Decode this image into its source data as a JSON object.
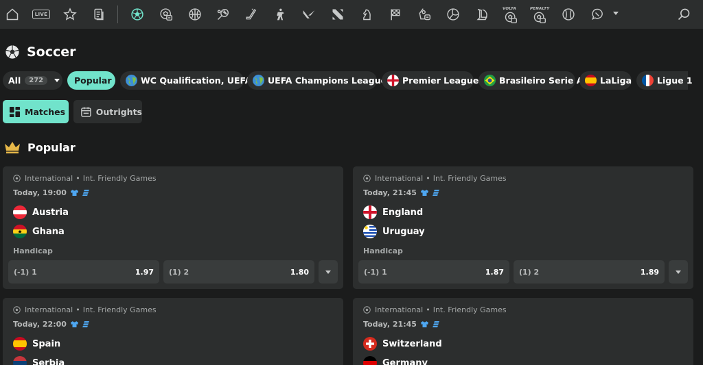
{
  "topbar": {
    "live_label": "LIVE",
    "volta_label": "VOLTA",
    "penalty_label": "PENALTY",
    "icons": [
      "home-icon",
      "live-icon",
      "star-icon",
      "betslip-icon",
      "soccer-icon",
      "esoccer-icon",
      "basketball-icon",
      "tennis-icon",
      "hockey-icon",
      "counter-strike-icon",
      "valorant-icon",
      "dota-icon",
      "chess-icon",
      "racing-flag-icon",
      "ebasketball-icon",
      "volleyball-icon",
      "league-of-legends-icon",
      "volta-icon",
      "penalty-icon",
      "baseball-icon",
      "chat-icon",
      "search-icon"
    ]
  },
  "page": {
    "title": "Soccer"
  },
  "filters": [
    {
      "label": "All",
      "count": "272"
    },
    {
      "label": "Popular"
    },
    {
      "label": "WC Qualification, UEFA"
    },
    {
      "label": "UEFA Champions League"
    },
    {
      "label": "Premier League"
    },
    {
      "label": "Brasileiro Serie A"
    },
    {
      "label": "LaLiga"
    },
    {
      "label": "Ligue 1"
    }
  ],
  "tabs": {
    "matches": "Matches",
    "outrights": "Outrights"
  },
  "section": {
    "title": "Popular"
  },
  "matches": [
    {
      "category": "International",
      "league": "Int. Friendly Games",
      "time": "Today, 19:00",
      "home": "Austria",
      "away": "Ghana",
      "market": "Handicap",
      "odds": [
        {
          "selection": "(-1) 1",
          "price": "1.97"
        },
        {
          "selection": "(1) 2",
          "price": "1.80"
        }
      ]
    },
    {
      "category": "International",
      "league": "Int. Friendly Games",
      "time": "Today, 21:45",
      "home": "England",
      "away": "Uruguay",
      "market": "Handicap",
      "odds": [
        {
          "selection": "(-1) 1",
          "price": "1.87"
        },
        {
          "selection": "(1) 2",
          "price": "1.89"
        }
      ]
    },
    {
      "category": "International",
      "league": "Int. Friendly Games",
      "time": "Today, 22:00",
      "home": "Spain",
      "away": "Serbia"
    },
    {
      "category": "International",
      "league": "Int. Friendly Games",
      "time": "Today, 21:45",
      "home": "Switzerland",
      "away": "Germany"
    }
  ],
  "colors": {
    "accent": "#71e3cb",
    "background": "#1b1c1c",
    "panel": "#2c2e2e",
    "button": "#393c3c",
    "stats_icon": "#4ea6f0",
    "crown": "#e8b949"
  }
}
